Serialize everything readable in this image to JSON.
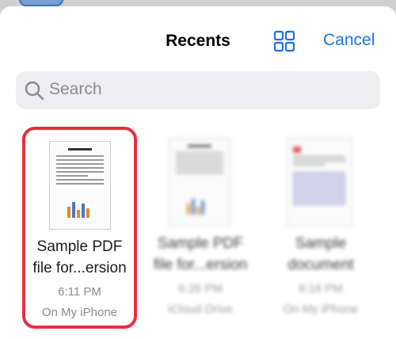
{
  "header": {
    "title": "Recents",
    "cancel_label": "Cancel",
    "view_toggle_icon": "grid-icon"
  },
  "search": {
    "placeholder": "Search",
    "icon": "magnifying-glass-icon"
  },
  "files": [
    {
      "name_line1": "Sample PDF",
      "name_line2": "file for...ersion",
      "time": "6:11 PM",
      "location": "On My iPhone",
      "selected": true
    },
    {
      "name_line1": "Sample PDF",
      "name_line2": "file for...ersion",
      "time": "6:26 PM",
      "location": "iCloud Drive",
      "selected": false
    },
    {
      "name_line1": "Sample",
      "name_line2": "document",
      "time": "6:16 PM",
      "location": "On My iPhone",
      "selected": false
    }
  ],
  "colors": {
    "accent": "#1a73e8",
    "selection_border": "#e53040"
  }
}
